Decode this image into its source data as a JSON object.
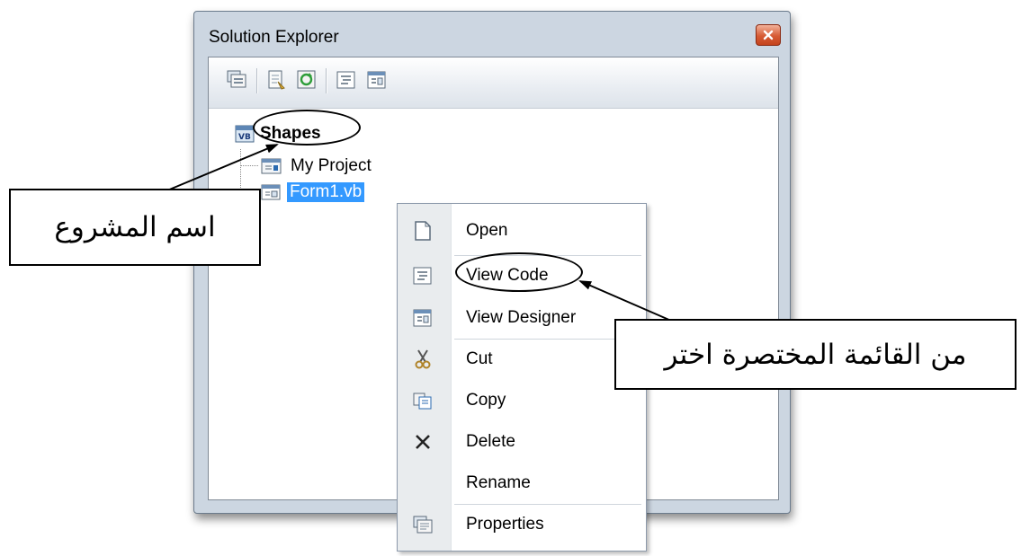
{
  "window": {
    "title": "Solution Explorer",
    "toolbar": [
      {
        "icon": "show-all-files-icon"
      },
      {
        "icon": "properties-icon"
      },
      {
        "icon": "refresh-icon"
      },
      {
        "icon": "view-code-icon"
      },
      {
        "icon": "view-designer-icon"
      }
    ]
  },
  "tree": {
    "project": "Shapes",
    "items": [
      {
        "label": "My Project",
        "icon": "my-project-icon"
      },
      {
        "label": "Form1.vb",
        "icon": "form-icon",
        "selected": true
      }
    ]
  },
  "context_menu": {
    "items": [
      {
        "label": "Open",
        "icon": "open-file-icon"
      },
      {
        "label": "View Code",
        "icon": "view-code-icon"
      },
      {
        "label": "View Designer",
        "icon": "view-designer-icon"
      },
      {
        "label": "Cut",
        "icon": "scissors-icon"
      },
      {
        "label": "Copy",
        "icon": "copy-icon"
      },
      {
        "label": "Delete",
        "icon": "delete-x-icon"
      },
      {
        "label": "Rename",
        "icon": ""
      },
      {
        "label": "Properties",
        "icon": "properties-icon"
      }
    ]
  },
  "annotations": {
    "project_name": "اسم المشروع",
    "context_menu_choose": "من القائمة المختصرة اختر"
  }
}
